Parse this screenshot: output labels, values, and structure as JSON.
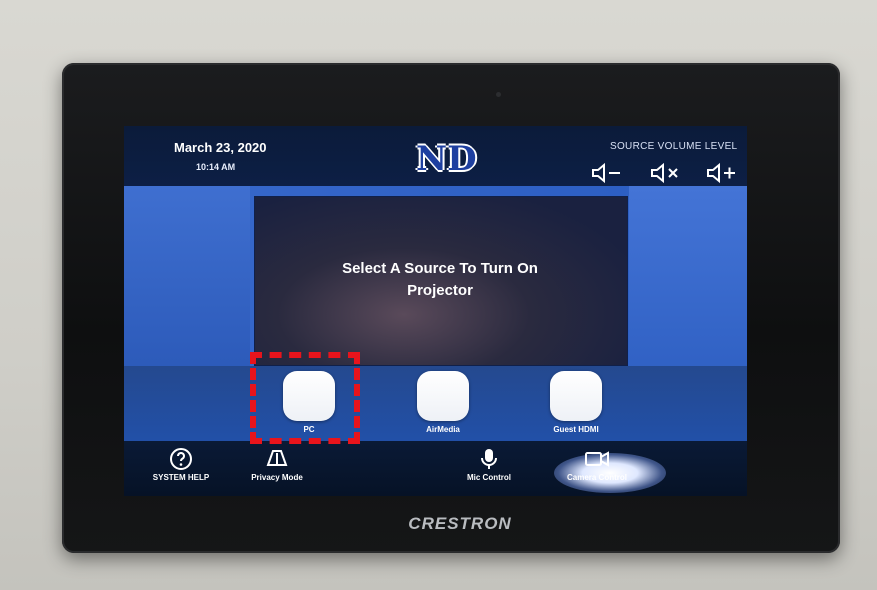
{
  "screen": {
    "date": "March 23, 2020",
    "time": "10:14 AM",
    "logo_text": "ND",
    "volume": {
      "title": "SOURCE VOLUME LEVEL",
      "down_icon": "speaker-minus-icon",
      "mute_icon": "speaker-mute-icon",
      "up_icon": "speaker-plus-icon"
    },
    "prompt_line1": "Select A Source To Turn On",
    "prompt_line2": "Projector",
    "sources": [
      {
        "label": "PC"
      },
      {
        "label": "AirMedia"
      },
      {
        "label": "Guest HDMI"
      }
    ],
    "nav": {
      "system_help": "SYSTEM HELP",
      "privacy_mode": "Privacy Mode",
      "center": "",
      "mic_control": "Mic Control",
      "camera_control": "Camera Control"
    }
  },
  "device": {
    "brand": "CRESTRON"
  },
  "colors": {
    "accent_blue": "#2d5fc4",
    "dark_bar": "#0b1b3a",
    "highlight_red": "#e8141c"
  }
}
